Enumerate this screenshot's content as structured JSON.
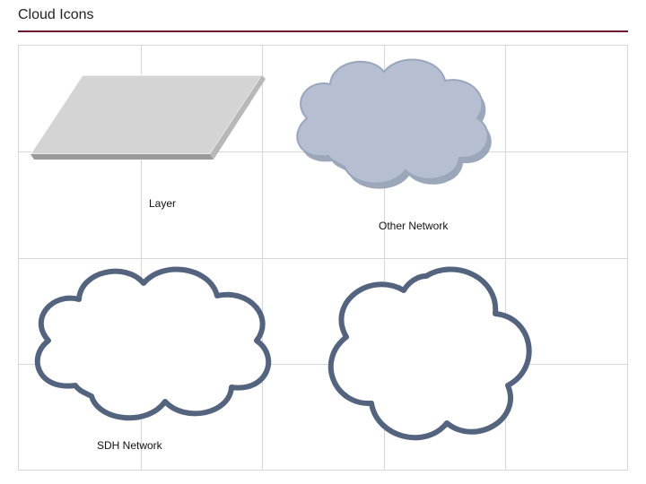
{
  "slide": {
    "title": "Cloud Icons"
  },
  "labels": {
    "layer": "Layer",
    "other_network": "Other Network",
    "sdh_network": "SDH Network"
  },
  "colors": {
    "title_rule": "#6b1a2e",
    "grid_line": "#d6d6d6",
    "parallelogram_fill": "#d4d4d4",
    "parallelogram_edge_dark": "#9a9a9a",
    "cloud_fill_solid": "#b5bfd1",
    "cloud_stroke": "#54647f",
    "cloud_shadow": "#8c98ae"
  },
  "icons": [
    {
      "name": "layer-parallelogram",
      "label_key": "layer"
    },
    {
      "name": "cloud-filled-other-network",
      "label_key": "other_network"
    },
    {
      "name": "cloud-outline-sdh-network",
      "label_key": "sdh_network"
    },
    {
      "name": "cloud-outline-6lobe"
    }
  ]
}
